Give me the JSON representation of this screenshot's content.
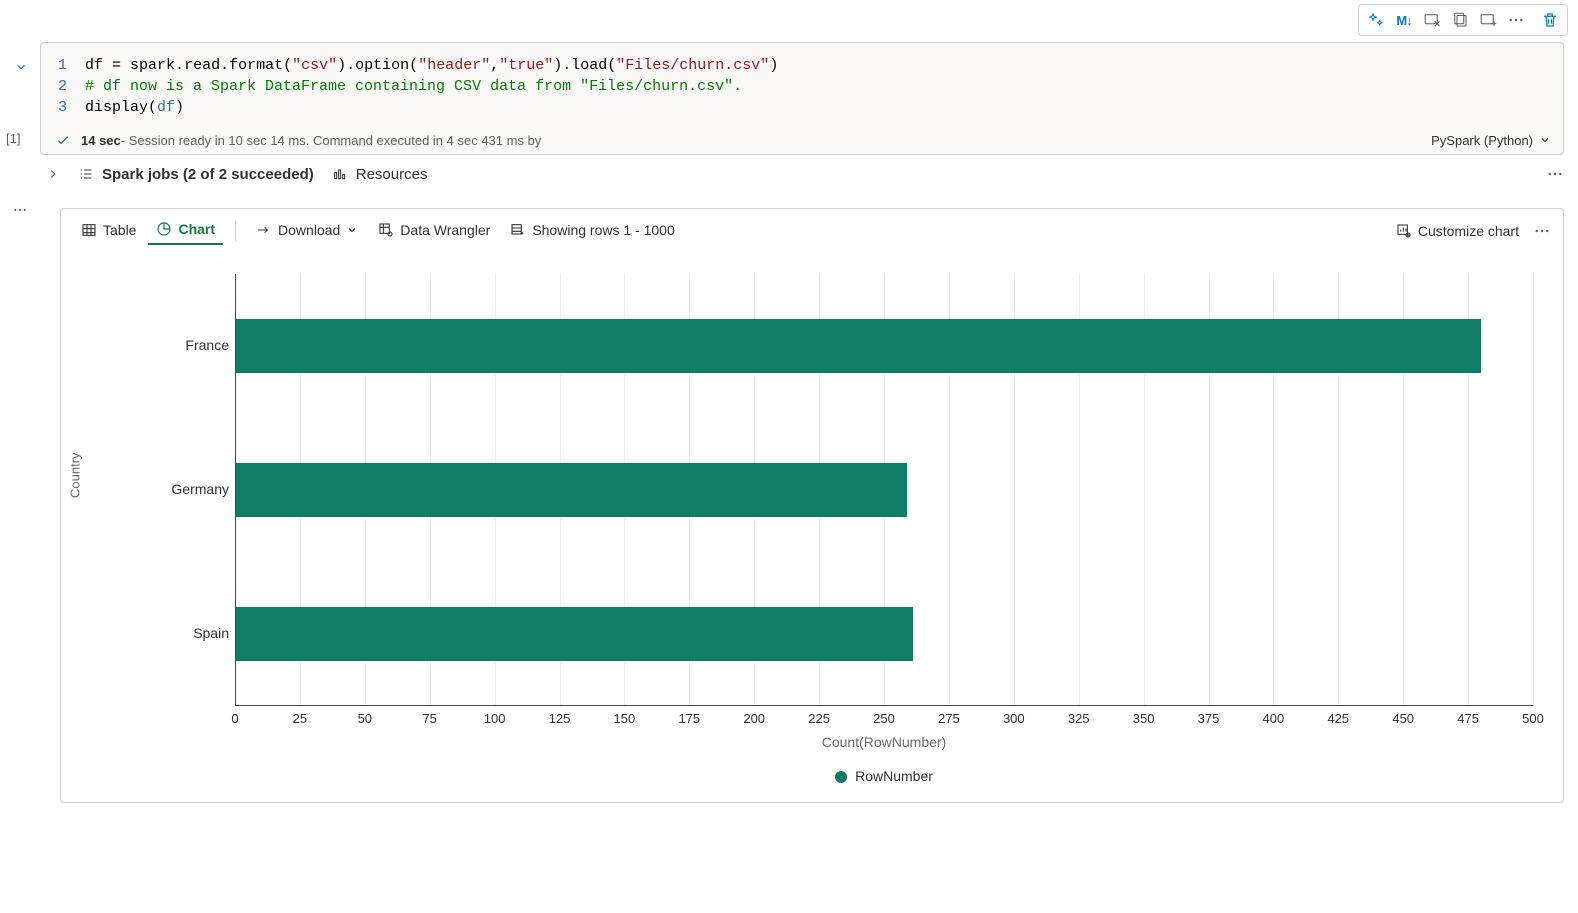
{
  "action_bar": {
    "copilot_icon": "copilot",
    "markdown_label": "M↓",
    "actions": [
      "add-cell-icon",
      "copy-cell-icon",
      "move-cell-icon"
    ]
  },
  "gutter": {
    "cell_index_label": "[1]"
  },
  "code": {
    "lines": [
      {
        "n": "1",
        "tokens": [
          {
            "t": "df",
            "c": "pln"
          },
          {
            "t": " = ",
            "c": "op"
          },
          {
            "t": "spark",
            "c": "pln"
          },
          {
            "t": ".",
            "c": "op"
          },
          {
            "t": "read",
            "c": "pln"
          },
          {
            "t": ".",
            "c": "op"
          },
          {
            "t": "format",
            "c": "pln"
          },
          {
            "t": "(",
            "c": "op"
          },
          {
            "t": "\"csv\"",
            "c": "str"
          },
          {
            "t": ").",
            "c": "op"
          },
          {
            "t": "option",
            "c": "pln"
          },
          {
            "t": "(",
            "c": "op"
          },
          {
            "t": "\"header\"",
            "c": "str"
          },
          {
            "t": ",",
            "c": "op"
          },
          {
            "t": "\"true\"",
            "c": "str"
          },
          {
            "t": ").",
            "c": "op"
          },
          {
            "t": "load",
            "c": "pln"
          },
          {
            "t": "(",
            "c": "op"
          },
          {
            "t": "\"Files/churn.csv\"",
            "c": "str"
          },
          {
            "t": ")",
            "c": "op"
          }
        ]
      },
      {
        "n": "2",
        "tokens": [
          {
            "t": "# df now is a Spark DataFrame containing CSV data from \"Files/churn.csv\".",
            "c": "com"
          }
        ]
      },
      {
        "n": "3",
        "tokens": [
          {
            "t": "display",
            "c": "pln"
          },
          {
            "t": "(",
            "c": "op"
          },
          {
            "t": "df",
            "c": "var"
          },
          {
            "t": ")",
            "c": "op"
          }
        ]
      }
    ]
  },
  "status": {
    "duration_bold": "14 sec",
    "rest": " - Session ready in 10 sec 14 ms. Command executed in 4 sec 431 ms by",
    "language_label": "PySpark (Python)"
  },
  "jobs": {
    "spark_jobs_label": "Spark jobs (2 of 2 succeeded)",
    "resources_label": "Resources"
  },
  "output_tabs": {
    "table_label": "Table",
    "chart_label": "Chart",
    "download_label": "Download",
    "data_wrangler_label": "Data Wrangler",
    "rows_label": "Showing rows 1 - 1000",
    "customize_label": "Customize chart"
  },
  "chart_data": {
    "type": "bar",
    "orientation": "horizontal",
    "categories": [
      "France",
      "Germany",
      "Spain"
    ],
    "values": [
      480,
      259,
      261
    ],
    "series": [
      {
        "name": "RowNumber",
        "values": [
          480,
          259,
          261
        ]
      }
    ],
    "ylabel": "Country",
    "xlabel": "Count(RowNumber)",
    "legend": "RowNumber",
    "x_ticks": [
      0,
      25,
      50,
      75,
      100,
      125,
      150,
      175,
      200,
      225,
      250,
      275,
      300,
      325,
      350,
      375,
      400,
      425,
      450,
      475,
      500
    ],
    "xlim": [
      0,
      500
    ],
    "color": "#107c65"
  }
}
